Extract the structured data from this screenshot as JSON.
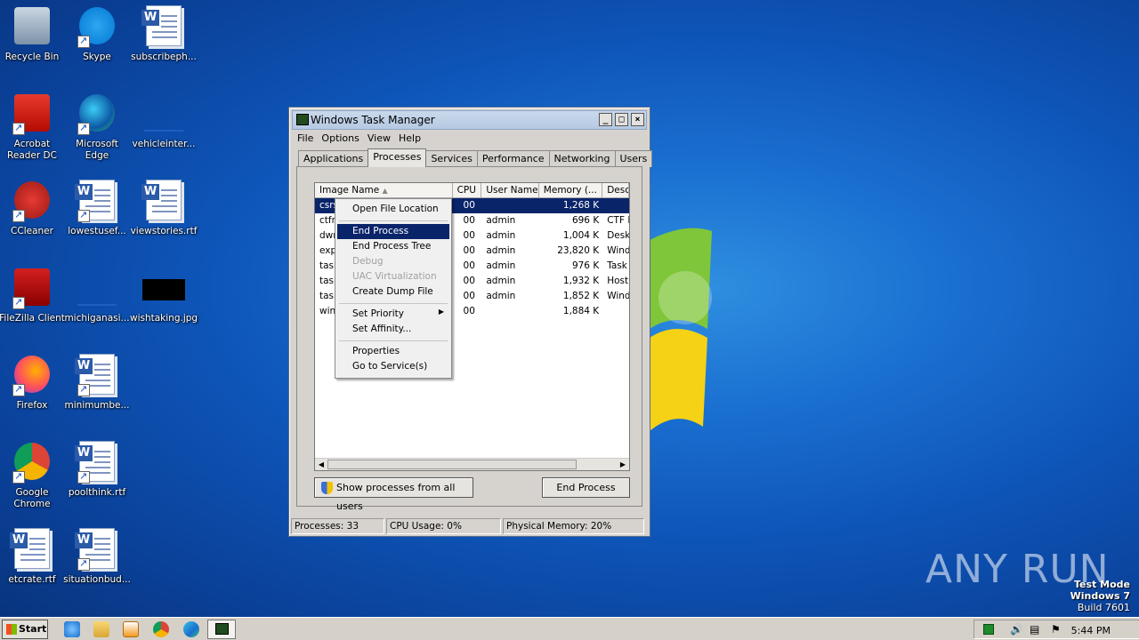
{
  "desktop": {
    "icons": [
      {
        "label": "Recycle Bin",
        "icon": "recycle-bin-icon"
      },
      {
        "label": "Skype",
        "icon": "skype-icon"
      },
      {
        "label": "subscribeph...",
        "icon": "word-doc-icon"
      },
      {
        "label": "Acrobat Reader DC",
        "icon": "acrobat-icon"
      },
      {
        "label": "Microsoft Edge",
        "icon": "edge-icon"
      },
      {
        "label": "vehicleinter...",
        "icon": "blank-file-icon"
      },
      {
        "label": "CCleaner",
        "icon": "ccleaner-icon"
      },
      {
        "label": "lowestusef...",
        "icon": "word-doc-icon"
      },
      {
        "label": "viewstories.rtf",
        "icon": "word-doc-icon"
      },
      {
        "label": "FileZilla Client",
        "icon": "filezilla-icon"
      },
      {
        "label": "michiganasi...",
        "icon": "blank-file-icon"
      },
      {
        "label": "wishtaking.jpg",
        "icon": "image-file-icon"
      },
      {
        "label": "Firefox",
        "icon": "firefox-icon"
      },
      {
        "label": "minimumbe...",
        "icon": "word-doc-icon"
      },
      {
        "label": "Google Chrome",
        "icon": "chrome-icon"
      },
      {
        "label": "poolthink.rtf",
        "icon": "word-doc-icon"
      },
      {
        "label": "etcrate.rtf",
        "icon": "word-doc-icon"
      },
      {
        "label": "situationbud...",
        "icon": "word-doc-icon"
      }
    ]
  },
  "window": {
    "title": "Windows Task Manager",
    "menu": [
      "File",
      "Options",
      "View",
      "Help"
    ],
    "tabs": [
      "Applications",
      "Processes",
      "Services",
      "Performance",
      "Networking",
      "Users"
    ],
    "active_tab": "Processes",
    "columns": [
      "Image Name",
      "CPU",
      "User Name",
      "Memory (...",
      "Desc"
    ],
    "rows": [
      {
        "name": "csrs",
        "cpu": "00",
        "user": "",
        "mem": "1,268 K",
        "desc": ""
      },
      {
        "name": "ctfm",
        "cpu": "00",
        "user": "admin",
        "mem": "696 K",
        "desc": "CTF L"
      },
      {
        "name": "dwm",
        "cpu": "00",
        "user": "admin",
        "mem": "1,004 K",
        "desc": "Deskt"
      },
      {
        "name": "exp",
        "cpu": "00",
        "user": "admin",
        "mem": "23,820 K",
        "desc": "Wind"
      },
      {
        "name": "task",
        "cpu": "00",
        "user": "admin",
        "mem": "976 K",
        "desc": "Task"
      },
      {
        "name": "task",
        "cpu": "00",
        "user": "admin",
        "mem": "1,932 K",
        "desc": "Host"
      },
      {
        "name": "task",
        "cpu": "00",
        "user": "admin",
        "mem": "1,852 K",
        "desc": "Wind"
      },
      {
        "name": "winl",
        "cpu": "00",
        "user": "",
        "mem": "1,884 K",
        "desc": ""
      }
    ],
    "show_all_label": "Show processes from all users",
    "end_process_label": "End Process",
    "status": {
      "processes": "Processes: 33",
      "cpu": "CPU Usage: 0%",
      "memory": "Physical Memory: 20%"
    }
  },
  "context_menu": {
    "items": [
      {
        "label": "Open File Location",
        "state": "normal"
      },
      {
        "label": "End Process",
        "state": "highlighted"
      },
      {
        "label": "End Process Tree",
        "state": "normal"
      },
      {
        "label": "Debug",
        "state": "disabled"
      },
      {
        "label": "UAC Virtualization",
        "state": "disabled"
      },
      {
        "label": "Create Dump File",
        "state": "normal"
      },
      {
        "label": "Set Priority",
        "state": "submenu"
      },
      {
        "label": "Set Affinity...",
        "state": "normal"
      },
      {
        "label": "Properties",
        "state": "normal"
      },
      {
        "label": "Go to Service(s)",
        "state": "normal"
      }
    ]
  },
  "taskbar": {
    "start_label": "Start",
    "clock": "5:44 PM"
  },
  "watermark": {
    "line1": "Test Mode",
    "line2": "Windows 7",
    "line3": "Build 7601",
    "brand": "ANY RUN"
  }
}
